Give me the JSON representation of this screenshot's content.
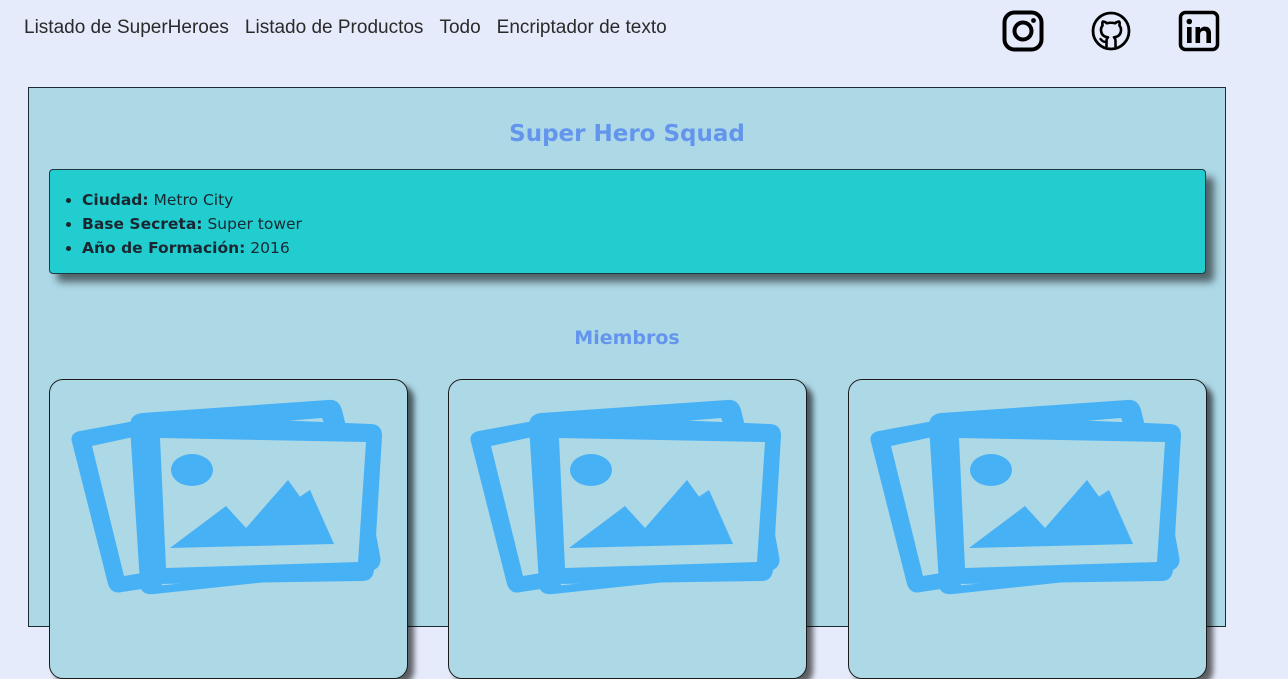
{
  "nav": {
    "items": [
      {
        "label": "Listado de SuperHeroes"
      },
      {
        "label": "Listado de Productos"
      },
      {
        "label": "Todo"
      },
      {
        "label": "Encriptador de texto"
      }
    ]
  },
  "social": {
    "icons": [
      "instagram-icon",
      "github-icon",
      "linkedin-icon"
    ]
  },
  "squad": {
    "title": "Super Hero Squad",
    "info": [
      {
        "label": "Ciudad:",
        "value": "Metro City"
      },
      {
        "label": "Base Secreta:",
        "value": "Super tower"
      },
      {
        "label": "Año de Formación:",
        "value": "2016"
      }
    ]
  },
  "members": {
    "title": "Miembros",
    "cards": [
      {
        "image": "image-placeholder-icon"
      },
      {
        "image": "image-placeholder-icon"
      },
      {
        "image": "image-placeholder-icon"
      }
    ]
  },
  "colors": {
    "page_bg": "#e6ebfb",
    "panel_bg": "#add8e6",
    "info_bg": "#22cdd0",
    "heading": "#6495ed",
    "placeholder": "#47b1f5"
  }
}
